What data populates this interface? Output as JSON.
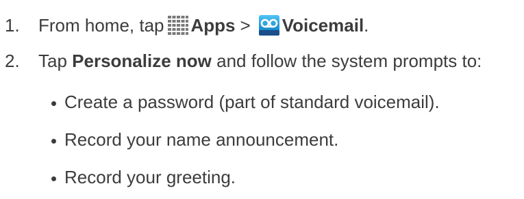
{
  "steps": [
    {
      "number": "1.",
      "text_before": "From home, tap",
      "apps_label": "Apps",
      "separator": ">",
      "voicemail_label": "Voicemail",
      "text_after": ".",
      "icons": [
        "apps-grid-icon",
        "voicemail-icon"
      ]
    },
    {
      "number": "2.",
      "text_before": "Tap",
      "action_label": "Personalize now",
      "text_after": "and follow the system prompts to:"
    }
  ],
  "bullets": [
    "Create a password (part of standard voicemail).",
    "Record your name announcement.",
    "Record your greeting."
  ],
  "colors": {
    "text": "#3c3c3c",
    "apps_icon": "#7a7a7a",
    "voicemail_icon_top": "#4fc3f7",
    "voicemail_icon_bottom": "#0277bd"
  }
}
